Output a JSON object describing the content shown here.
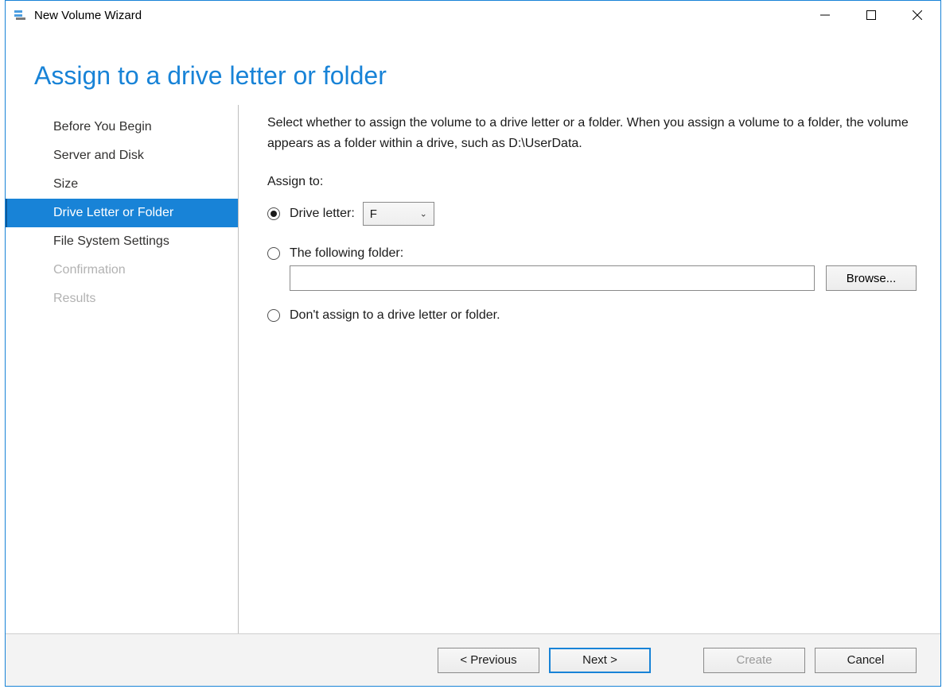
{
  "window": {
    "title": "New Volume Wizard"
  },
  "header": {
    "title": "Assign to a drive letter or folder"
  },
  "sidebar": {
    "steps": [
      {
        "label": "Before You Begin",
        "state": "normal"
      },
      {
        "label": "Server and Disk",
        "state": "normal"
      },
      {
        "label": "Size",
        "state": "normal"
      },
      {
        "label": "Drive Letter or Folder",
        "state": "active"
      },
      {
        "label": "File System Settings",
        "state": "normal"
      },
      {
        "label": "Confirmation",
        "state": "disabled"
      },
      {
        "label": "Results",
        "state": "disabled"
      }
    ]
  },
  "content": {
    "instruction": "Select whether to assign the volume to a drive letter or a folder. When you assign a volume to a folder, the volume appears as a folder within a drive, such as D:\\UserData.",
    "assign_to_label": "Assign to:",
    "options": {
      "drive_letter": {
        "label": "Drive letter:",
        "selected": true,
        "value": "F"
      },
      "folder": {
        "label": "The following folder:",
        "selected": false,
        "value": "",
        "browse_label": "Browse..."
      },
      "none": {
        "label": "Don't assign to a drive letter or folder.",
        "selected": false
      }
    }
  },
  "footer": {
    "previous": "< Previous",
    "next": "Next >",
    "create": "Create",
    "cancel": "Cancel"
  }
}
